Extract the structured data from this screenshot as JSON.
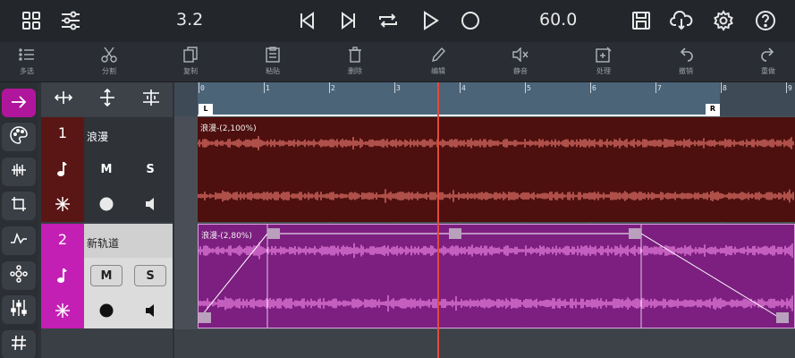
{
  "topbar": {
    "position": "3.2",
    "tempo": "60.0",
    "icons": [
      "grid-icon",
      "mixer-sliders-icon",
      "skip-start-icon",
      "skip-end-icon",
      "loop-icon",
      "play-icon",
      "record-icon",
      "save-icon",
      "cloud-download-icon",
      "gear-icon",
      "help-icon"
    ]
  },
  "toolbar": {
    "items": [
      {
        "label": "多选",
        "icon": "multiselect-icon"
      },
      {
        "label": "分割",
        "icon": "scissors-icon"
      },
      {
        "label": "复制",
        "icon": "copy-icon"
      },
      {
        "label": "粘贴",
        "icon": "paste-icon"
      },
      {
        "label": "删除",
        "icon": "trash-icon"
      },
      {
        "label": "编辑",
        "icon": "pencil-icon"
      },
      {
        "label": "静音",
        "icon": "mute-icon"
      },
      {
        "label": "处理",
        "icon": "process-icon"
      },
      {
        "label": "撤销",
        "icon": "undo-icon"
      },
      {
        "label": "重做",
        "icon": "redo-icon"
      }
    ]
  },
  "ruler": {
    "numbers": [
      "0",
      "1",
      "2",
      "3",
      "4",
      "5",
      "6",
      "7",
      "8",
      "9"
    ],
    "loop_start": "L",
    "loop_end": "R"
  },
  "tracks": [
    {
      "number": "1",
      "name": "浪漫",
      "mute": "M",
      "solo": "S",
      "clip_label": "浪漫-(2,100%)",
      "color": "#5a1614"
    },
    {
      "number": "2",
      "name": "新轨道",
      "mute": "M",
      "solo": "S",
      "clip_label": "浪漫-(2,80%)",
      "color": "#c31fb5"
    }
  ],
  "colors": {
    "accent": "#b0169b",
    "playhead": "#e24b3c",
    "track1_wave": "#f07a72",
    "track2_wave": "#f58ae8"
  }
}
